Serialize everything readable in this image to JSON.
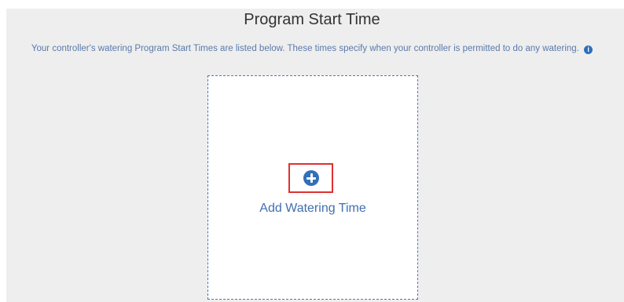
{
  "section": {
    "title": "Program Start Time",
    "description": "Your controller's watering Program Start Times are listed below. These times specify when your controller is permitted to do any watering.",
    "info_icon": "info-circle-icon",
    "add_button_label": "Add Watering Time",
    "add_icon": "plus-circle-icon"
  },
  "colors": {
    "panel_background": "#eeeeee",
    "accent_blue": "#336fb8",
    "highlight_red": "#e03030"
  }
}
